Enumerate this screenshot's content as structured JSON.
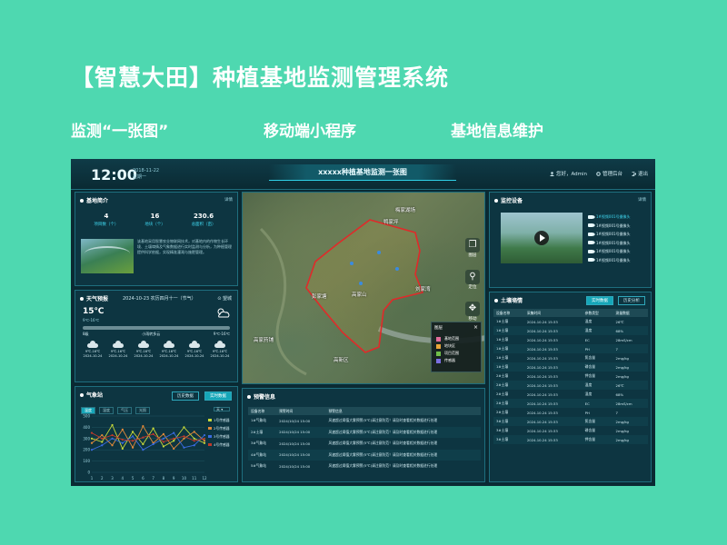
{
  "slide": {
    "title": "【智慧大田】种植基地监测管理系统",
    "subtitle_1": "监测“一张图”",
    "subtitle_2": "移动端小程序",
    "subtitle_3": "基地信息维护"
  },
  "header": {
    "time": "12:00",
    "date_line1": "2018-11-22",
    "date_line2": "星期一",
    "title": "xxxxx种植基地监测一张图",
    "user": "您好，Admin",
    "settings": "管理后台",
    "logout": "退出"
  },
  "base_intro": {
    "title": "基地简介",
    "more": "详情",
    "stats": [
      {
        "value": "4",
        "label": "项目数（个）"
      },
      {
        "value": "16",
        "label": "地块（个）"
      },
      {
        "value": "230.6",
        "label": "总面积（亩）"
      }
    ],
    "description": "该基地采用智慧农业物联网技术，对基地内的作物生长环境、土壤墒情及气象数据进行实时监测与分析，为种植管理提供科学依据，实现精准灌溉与施肥管理。"
  },
  "weather": {
    "title": "天气预报",
    "date": "2024-10-23  农历四月十一（节气）",
    "city": "望城",
    "temp": "15℃",
    "temp_range": "9℃-16℃",
    "aq_left": "8级",
    "aq_mid": "小雨转多云",
    "aq_right": "9℃-16℃",
    "forecast": [
      {
        "range": "9℃-16℃",
        "date": "2024-10-24"
      },
      {
        "range": "9℃-16℃",
        "date": "2024-10-24"
      },
      {
        "range": "9℃-16℃",
        "date": "2024-10-24"
      },
      {
        "range": "9℃-16℃",
        "date": "2024-10-24"
      },
      {
        "range": "9℃-16℃",
        "date": "2024-10-24"
      },
      {
        "range": "9℃-16℃",
        "date": "2024-10-24"
      }
    ]
  },
  "station": {
    "title": "气象站",
    "btn_history": "历史数据",
    "btn_realtime": "实时数据",
    "tabs": [
      "温度",
      "湿度",
      "气压",
      "光照"
    ],
    "unit": "天",
    "legend": [
      "1号传感器",
      "2号传感器",
      "3号传感器",
      "4号传感器"
    ]
  },
  "chart_data": {
    "type": "line",
    "x": [
      1,
      2,
      3,
      4,
      5,
      6,
      7,
      8,
      9,
      10,
      11,
      12
    ],
    "ylim": [
      0,
      500
    ],
    "yticks": [
      0,
      100,
      200,
      300,
      400,
      500
    ],
    "series": [
      {
        "name": "1号传感器",
        "color": "#c7d93a",
        "values": [
          300,
          270,
          420,
          210,
          360,
          250,
          390,
          230,
          280,
          400,
          300,
          260
        ]
      },
      {
        "name": "2号传感器",
        "color": "#e0893a",
        "values": [
          260,
          330,
          240,
          380,
          220,
          410,
          260,
          340,
          210,
          300,
          360,
          280
        ]
      },
      {
        "name": "3号传感器",
        "color": "#3a6be0",
        "values": [
          200,
          240,
          300,
          260,
          320,
          200,
          250,
          300,
          350,
          220,
          240,
          330
        ]
      },
      {
        "name": "4号传感器",
        "color": "#c0392b",
        "values": [
          350,
          300,
          330,
          290,
          280,
          310,
          340,
          270,
          300,
          320,
          280,
          300
        ]
      }
    ]
  },
  "map": {
    "labels": [
      "梅家湖场",
      "鸭家坪",
      "彭家塘",
      "高家山",
      "刘家湾",
      "高家药铺",
      "高新区"
    ],
    "tool_layers": "图层",
    "tool_locate": "定位",
    "tool_move": "移动",
    "legend_title": "图层",
    "legend_items": [
      {
        "label": "基地范围",
        "color": "#e06b9a"
      },
      {
        "label": "地块区",
        "color": "#e8a63a"
      },
      {
        "label": "项目范围",
        "color": "#6fbf4a"
      },
      {
        "label": "传感器",
        "color": "#7a6ee0"
      }
    ]
  },
  "alerts": {
    "title": "预警信息",
    "headers": [
      "设备名称",
      "预警时间",
      "预警信息"
    ],
    "rows": [
      [
        "1#气象站",
        "2024/10/24 15:00",
        "风速超过阈值大雾预警(5℃)请注意防范！请及时查看相关数据进行处理"
      ],
      [
        "2#土壤",
        "2024/10/24 15:00",
        "风速超过阈值大雾预警(5℃)请注意防范！请及时查看相关数据进行处理"
      ],
      [
        "3#气象站",
        "2024/10/24 15:00",
        "风速超过阈值大雾预警(5℃)请注意防范！请及时查看相关数据进行处理"
      ],
      [
        "4#气象站",
        "2024/10/24 15:00",
        "风速超过阈值大雾预警(5℃)请注意防范！请及时查看相关数据进行处理"
      ],
      [
        "5#气象站",
        "2024/10/24 15:00",
        "风速超过阈值大雾预警(5℃)请注意防范！请及时查看相关数据进行处理"
      ]
    ]
  },
  "monitor": {
    "title": "监控设备",
    "more": "详情",
    "cameras": [
      "1#视频001号摄像头",
      "1#视频001号摄像头",
      "1#视频001号摄像头",
      "1#视频001号摄像头",
      "1#视频001号摄像头",
      "1#视频001号摄像头"
    ]
  },
  "soil": {
    "title": "土壤墒情",
    "tab_realtime": "实时数据",
    "tab_history": "历史分析",
    "headers": [
      "设备名称",
      "采集时间",
      "参数类型",
      "测量数据"
    ],
    "rows": [
      [
        "1#土壤",
        "2024.10.24 15:33",
        "温度",
        "26℃"
      ],
      [
        "1#土壤",
        "2024.10.24 15:33",
        "湿度",
        "68%"
      ],
      [
        "1#土壤",
        "2024.10.24 15:33",
        "EC",
        "28mS/cm"
      ],
      [
        "1#土壤",
        "2024.10.24 15:33",
        "PH",
        "7"
      ],
      [
        "1#土壤",
        "2024.10.24 15:33",
        "氮含量",
        "2mg/kg"
      ],
      [
        "1#土壤",
        "2024.10.24 15:33",
        "磷含量",
        "2mg/kg"
      ],
      [
        "2#土壤",
        "2024.10.24 15:33",
        "钾含量",
        "2mg/kg"
      ],
      [
        "2#土壤",
        "2024.10.24 15:33",
        "温度",
        "26℃"
      ],
      [
        "2#土壤",
        "2024.10.24 15:33",
        "湿度",
        "68%"
      ],
      [
        "2#土壤",
        "2024.10.24 15:33",
        "EC",
        "28mS/cm"
      ],
      [
        "2#土壤",
        "2024.10.24 15:33",
        "PH",
        "7"
      ],
      [
        "3#土壤",
        "2024.10.24 15:33",
        "氮含量",
        "2mg/kg"
      ],
      [
        "3#土壤",
        "2024.10.24 15:33",
        "磷含量",
        "2mg/kg"
      ],
      [
        "3#土壤",
        "2024.10.24 15:33",
        "钾含量",
        "2mg/kg"
      ]
    ]
  }
}
